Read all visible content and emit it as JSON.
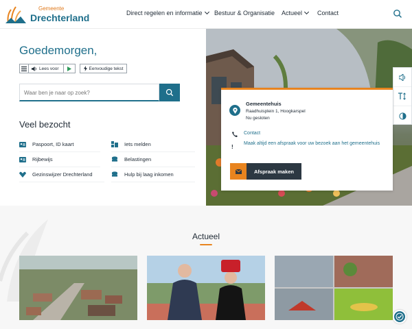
{
  "header": {
    "logo_small": "Gemeente",
    "logo_big": "Drechterland",
    "nav": [
      {
        "label": "Direct regelen en informatie",
        "has_dropdown": true
      },
      {
        "label": "Bestuur & Organisatie",
        "has_dropdown": false
      },
      {
        "label": "Actueel",
        "has_dropdown": true
      },
      {
        "label": "Contact",
        "has_dropdown": false
      }
    ]
  },
  "main": {
    "greeting": "Goedemorgen,",
    "read_aloud_label": "Lees voor",
    "easy_text_label": "Eenvoudige tekst",
    "search_placeholder": "Waar ben je naar op zoek?",
    "veel_bezocht_title": "Veel bezocht",
    "links_left": [
      {
        "label": "Paspoort, ID kaart",
        "icon": "id-card-icon"
      },
      {
        "label": "Rijbewijs",
        "icon": "license-icon"
      },
      {
        "label": "Gezinswijzer Drechterland",
        "icon": "family-icon"
      }
    ],
    "links_right": [
      {
        "label": "Iets melden",
        "icon": "report-icon"
      },
      {
        "label": "Belastingen",
        "icon": "coins-icon"
      },
      {
        "label": "Hulp bij laag inkomen",
        "icon": "coins-icon"
      }
    ]
  },
  "card": {
    "title": "Gemeentehuis",
    "address": "Raadhuisplein 1, Hoogkarspel",
    "status": "Nu gesloten",
    "contact_label": "Contact",
    "appointment_text": "Maak altijd een afspraak voor uw bezoek aan het gemeentehuis",
    "appointment_button": "Afspraak maken"
  },
  "actueel": {
    "title": "Actueel"
  },
  "colors": {
    "brand": "#1f6f8b",
    "accent": "#e8841f",
    "dark": "#2c3842"
  }
}
